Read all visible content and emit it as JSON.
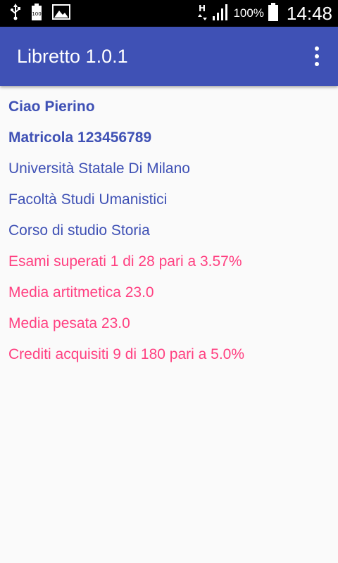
{
  "status_bar": {
    "icons": [
      "usb-icon",
      "battery-saver-icon",
      "image-icon",
      "hplus-data-icon",
      "signal-icon",
      "battery-icon"
    ],
    "battery_badge": "100",
    "network_type": "H",
    "battery_percent": "100%",
    "time": "14:48"
  },
  "toolbar": {
    "title": "Libretto 1.0.1",
    "overflow_icon": "more-vert-icon",
    "color": "#3f51b5"
  },
  "student": {
    "greeting": "Ciao Pierino",
    "matricola": "Matricola 123456789",
    "university": "Università Statale Di Milano",
    "faculty": "Facoltà Studi Umanistici",
    "course": "Corso di studio Storia"
  },
  "stats": {
    "exams_passed": "Esami superati 1 di 28 pari a 3.57%",
    "arithmetic_mean": "Media artitmetica 23.0",
    "weighted_mean": "Media pesata 23.0",
    "credits": "Crediti acquisiti 9 di 180 pari a 5.0%"
  },
  "colors": {
    "primary": "#3f51b5",
    "accent": "#ff4081",
    "background": "#fafafa"
  }
}
